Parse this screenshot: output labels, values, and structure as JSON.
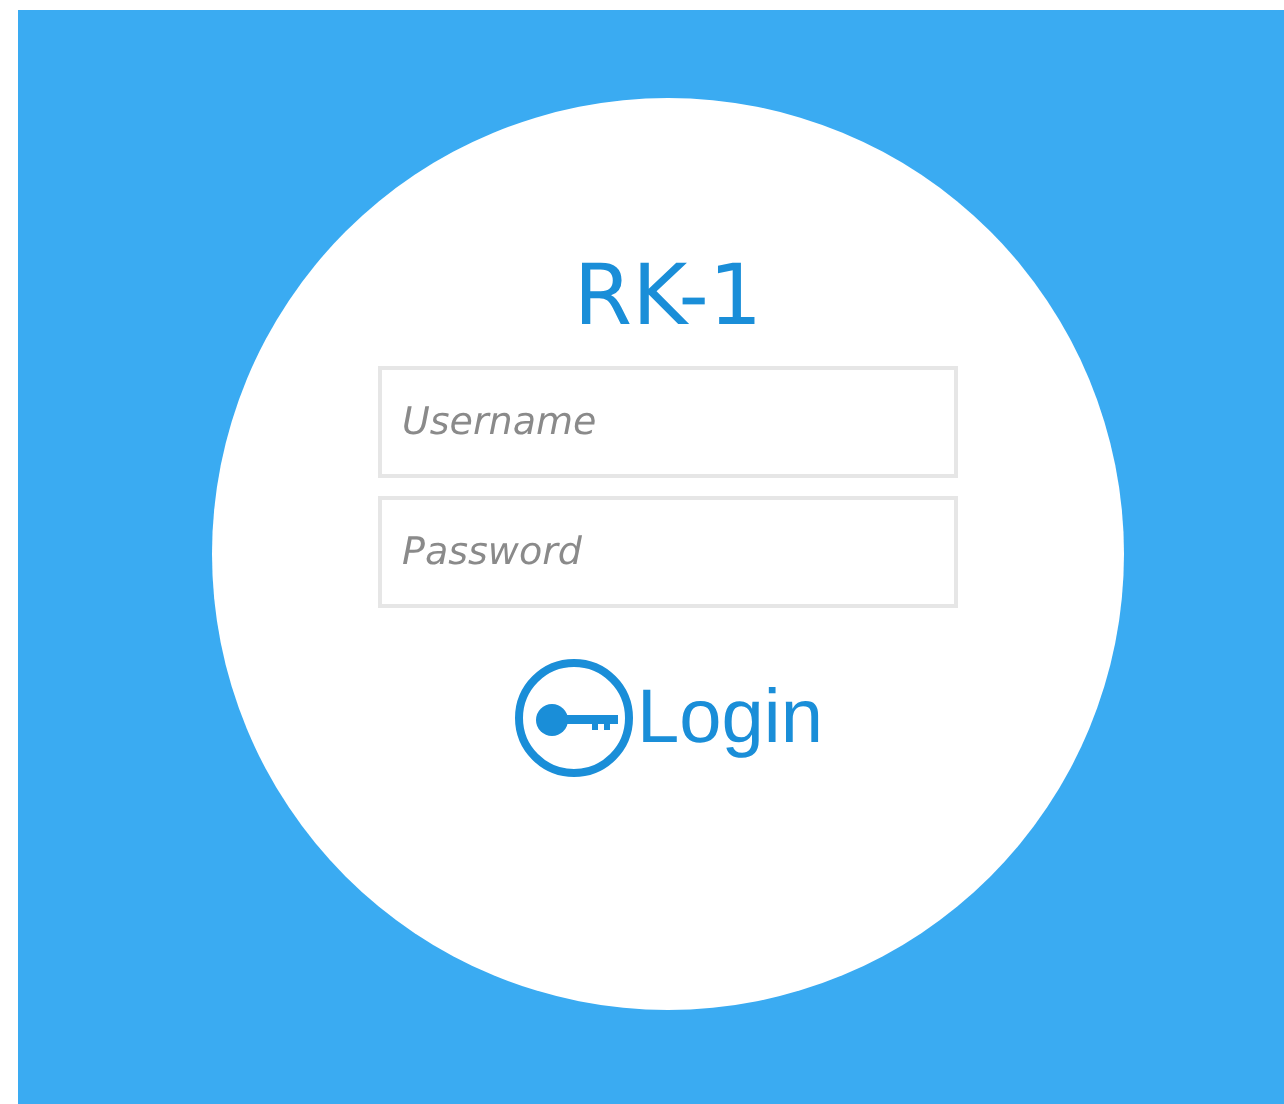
{
  "title": "RK-1",
  "fields": [
    {
      "placeholder": "Username"
    },
    {
      "placeholder": "Password"
    }
  ],
  "login_button": {
    "label": "Login"
  }
}
